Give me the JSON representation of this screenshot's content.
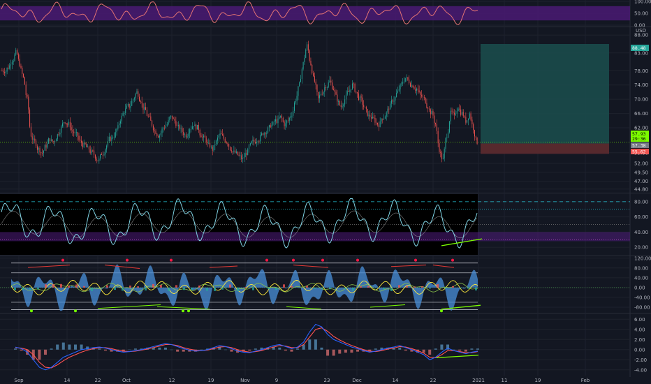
{
  "colors": {
    "background": "#131722",
    "grid": "#1e222d",
    "bull_candle": "#26a69a",
    "bear_candle": "#ef5350",
    "rsi_line": "#7fd3e3",
    "stoch_line": "#e57373",
    "band_purple": "#4a1a73",
    "target_zone": "#1b4b4b",
    "stop_zone": "#5a2a2e",
    "divergence_line": "#7cfc00",
    "macd_line": "#2962ff",
    "signal_line": "#ff5252"
  },
  "chart_data": [
    {
      "type": "line",
      "panel": "stochastic",
      "y_ticks": [
        "100.00",
        "50.00",
        "0.00"
      ],
      "ylim": [
        0,
        100
      ],
      "band": [
        20,
        80
      ]
    },
    {
      "type": "candlestick",
      "panel": "price",
      "currency": "USD",
      "y_ticks": [
        "88.00",
        "83.00",
        "78.00",
        "74.00",
        "70.00",
        "66.00",
        "62.00",
        "55.00",
        "52.00",
        "49.50",
        "47.00",
        "44.80"
      ],
      "ylim": [
        44,
        90
      ],
      "price_tags": {
        "target": "88.48",
        "current": "57.93",
        "countdown": "29:36",
        "entry": "57.38",
        "stop": "55.62"
      },
      "position": {
        "target": 85.5,
        "entry": 57.6,
        "stop": 54.7
      },
      "closes": [
        78,
        79,
        81,
        83,
        80,
        76,
        70,
        60,
        58,
        56,
        55,
        57,
        59,
        58,
        60,
        62,
        64,
        63,
        61,
        60,
        58,
        57,
        56,
        55,
        54,
        53,
        55,
        57,
        59,
        60,
        62,
        65,
        67,
        68,
        70,
        72,
        70,
        67,
        65,
        63,
        61,
        60,
        62,
        63,
        65,
        64,
        62,
        61,
        60,
        62,
        63,
        62,
        60,
        59,
        57,
        56,
        58,
        60,
        59,
        58,
        56,
        55,
        54,
        53,
        55,
        57,
        58,
        59,
        60,
        61,
        62,
        63,
        64,
        65,
        63,
        64,
        66,
        70,
        74,
        80,
        85,
        80,
        75,
        70,
        72,
        74,
        75,
        73,
        70,
        68,
        70,
        72,
        74,
        72,
        70,
        68,
        66,
        65,
        64,
        63,
        65,
        66,
        68,
        70,
        72,
        74,
        76,
        75,
        74,
        73,
        71,
        70,
        68,
        66,
        63,
        56,
        53,
        60,
        66,
        65,
        68,
        66,
        64,
        66,
        62,
        58
      ]
    },
    {
      "type": "line",
      "panel": "rsi",
      "y_ticks": [
        "80.00",
        "60.00",
        "40.00",
        "20.00"
      ],
      "ylim": [
        10,
        90
      ],
      "levels": [
        80,
        70,
        50,
        30
      ]
    },
    {
      "type": "area",
      "panel": "oscillator",
      "y_ticks": [
        "120.00",
        "80.00",
        "40.00",
        "0.00",
        "-40.00",
        "-80.00"
      ],
      "ylim": [
        -100,
        125
      ]
    },
    {
      "type": "line",
      "panel": "macd",
      "y_ticks": [
        "6.00",
        "4.00",
        "2.00",
        "0.00",
        "-2.00",
        "-4.00"
      ],
      "ylim": [
        -5,
        7
      ],
      "series": [
        {
          "values": [
            0.5,
            0.2,
            -0.5,
            -2.0,
            -3.5,
            -4.0,
            -3.5,
            -2.5,
            -1.5,
            -1.0,
            -0.5,
            0.0,
            0.2,
            0.4,
            0.5,
            0.3,
            0.0,
            -0.3,
            -0.5,
            -0.4,
            -0.2,
            0.0,
            0.3,
            0.6,
            0.9,
            1.2,
            1.0,
            0.6,
            0.2,
            -0.1,
            -0.3,
            -0.2,
            0.0,
            0.4,
            0.8,
            0.6,
            0.2,
            -0.3,
            -0.5,
            -0.6,
            -0.3,
            0.0,
            0.4,
            0.8,
            1.0,
            0.6,
            0.2,
            0.5,
            1.5,
            3.5,
            5.0,
            4.5,
            3.0,
            2.0,
            1.5,
            1.0,
            0.5,
            0.2,
            -0.2,
            -0.5,
            -0.3,
            0.0,
            0.3,
            0.5,
            0.8,
            0.4,
            0.0,
            -0.5,
            -1.0,
            -2.0,
            -1.5,
            -0.5,
            0.3,
            -0.2,
            -0.5,
            -0.8,
            -0.5,
            -0.3
          ]
        },
        {
          "values": [
            0.4,
            0.3,
            0.0,
            -1.0,
            -2.5,
            -3.5,
            -3.6,
            -3.0,
            -2.2,
            -1.5,
            -1.0,
            -0.5,
            -0.1,
            0.2,
            0.4,
            0.4,
            0.2,
            -0.1,
            -0.3,
            -0.4,
            -0.3,
            -0.1,
            0.1,
            0.4,
            0.7,
            1.0,
            1.0,
            0.8,
            0.4,
            0.1,
            -0.1,
            -0.2,
            -0.1,
            0.2,
            0.5,
            0.6,
            0.4,
            0.0,
            -0.3,
            -0.5,
            -0.4,
            -0.2,
            0.2,
            0.5,
            0.8,
            0.7,
            0.4,
            0.4,
            1.0,
            2.5,
            4.0,
            4.3,
            3.6,
            2.6,
            1.9,
            1.3,
            0.8,
            0.4,
            0.0,
            -0.3,
            -0.4,
            -0.2,
            0.1,
            0.3,
            0.6,
            0.5,
            0.2,
            -0.2,
            -0.7,
            -1.5,
            -1.6,
            -1.0,
            -0.2,
            -0.2,
            -0.4,
            -0.6,
            -0.6,
            -0.4
          ]
        }
      ]
    }
  ],
  "x_axis": {
    "labels": [
      "Sep",
      "14",
      "22",
      "Oct",
      "12",
      "19",
      "Nov",
      "9",
      "23",
      "Dec",
      "14",
      "22",
      "2021",
      "11",
      "19",
      "Feb"
    ]
  }
}
